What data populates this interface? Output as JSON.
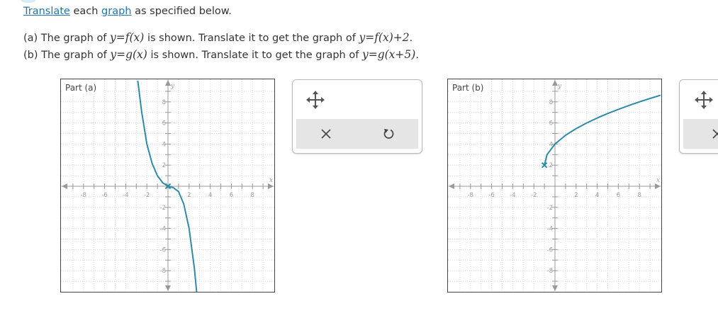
{
  "instruction": {
    "translate_link": "Translate",
    "each": " each ",
    "graph_link": "graph",
    "rest": " as specified below."
  },
  "part_a_question": {
    "p1": "(a) The graph of ",
    "m1": "y=f(x)",
    "p2": " is shown. Translate it to get the graph of ",
    "m2": "y=f(x)+2",
    "p3": "."
  },
  "part_b_question": {
    "p1": "(b) The graph of ",
    "m1": "y=g(x)",
    "p2": " is shown. Translate it to get the graph of ",
    "m2": "y=g(x+5)",
    "p3": "."
  },
  "graph_a": {
    "label": "Part (a)",
    "x_axis_label": "x",
    "y_axis_label": "y",
    "x_ticks": [
      "-8",
      "-6",
      "-4",
      "-2",
      "2",
      "4",
      "6",
      "8"
    ],
    "y_ticks": [
      "8",
      "6",
      "4",
      "2",
      "-2",
      "-4",
      "-6",
      "-8"
    ],
    "curve": [
      [
        -2.86,
        10.0
      ],
      [
        -2.5,
        7.08
      ],
      [
        -2.0,
        4.0
      ],
      [
        -1.5,
        2.15
      ],
      [
        -1.0,
        1.0
      ],
      [
        -0.5,
        0.33
      ],
      [
        0.0,
        0.0
      ],
      [
        0.5,
        -0.13
      ],
      [
        1.0,
        -0.5
      ],
      [
        1.5,
        -1.69
      ],
      [
        2.0,
        -4.0
      ],
      [
        2.5,
        -7.81
      ],
      [
        2.71,
        -10.0
      ]
    ],
    "marked_point": [
      0,
      0
    ]
  },
  "graph_b": {
    "label": "Part (b)",
    "x_axis_label": "x",
    "y_axis_label": "y",
    "x_ticks": [
      "-8",
      "-6",
      "-4",
      "-2",
      "2",
      "4",
      "6",
      "8"
    ],
    "y_ticks": [
      "8",
      "6",
      "4",
      "2",
      "-2",
      "-4",
      "-6",
      "-8"
    ],
    "curve": [
      [
        -1.0,
        2.0
      ],
      [
        -0.75,
        3.0
      ],
      [
        0.0,
        4.0
      ],
      [
        1.0,
        4.83
      ],
      [
        2.0,
        5.46
      ],
      [
        3.0,
        6.0
      ],
      [
        4.0,
        6.47
      ],
      [
        5.0,
        6.9
      ],
      [
        6.0,
        7.29
      ],
      [
        7.0,
        7.66
      ],
      [
        8.0,
        8.0
      ],
      [
        9.0,
        8.32
      ],
      [
        10.0,
        8.63
      ]
    ],
    "marked_point": [
      -1,
      2
    ]
  },
  "colors": {
    "curve": "#2e8aa8",
    "axis": "#999999",
    "grid": "#d6d6d6",
    "link": "#2574a9"
  },
  "icons": {
    "move": "move-arrows-icon",
    "clear": "close-x-icon",
    "undo": "undo-icon"
  }
}
